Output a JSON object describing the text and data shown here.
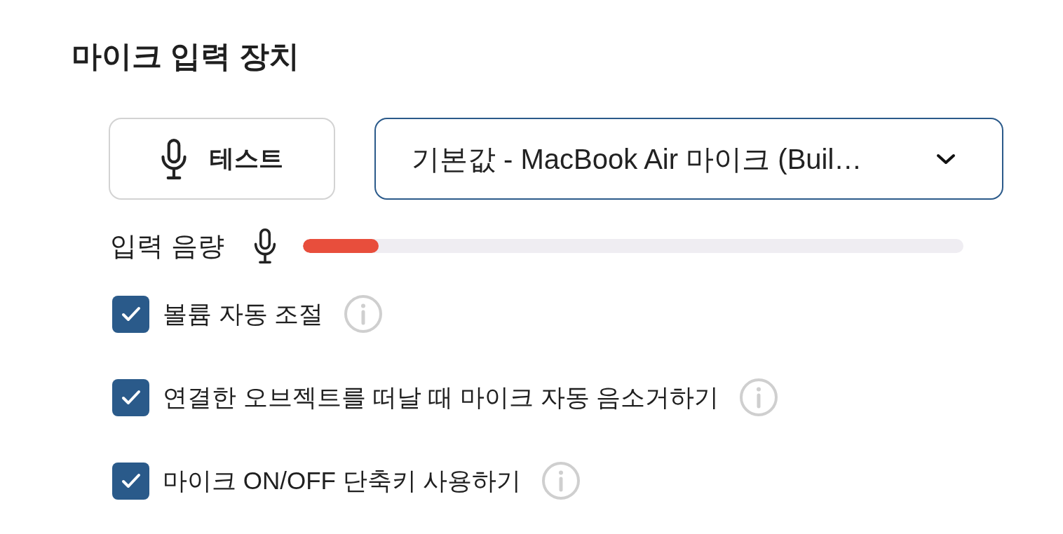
{
  "section": {
    "title": "마이크 입력 장치"
  },
  "test_button": {
    "label": "테스트"
  },
  "device_select": {
    "value": "기본값 - MacBook Air 마이크 (Buil…"
  },
  "input_volume": {
    "label": "입력 음량",
    "level": 0.115
  },
  "options": [
    {
      "label": "볼륨 자동 조절",
      "checked": true
    },
    {
      "label": "연결한 오브젝트를 떠날 때 마이크 자동 음소거하기",
      "checked": true
    },
    {
      "label": "마이크 ON/OFF 단축키 사용하기",
      "checked": true
    }
  ]
}
